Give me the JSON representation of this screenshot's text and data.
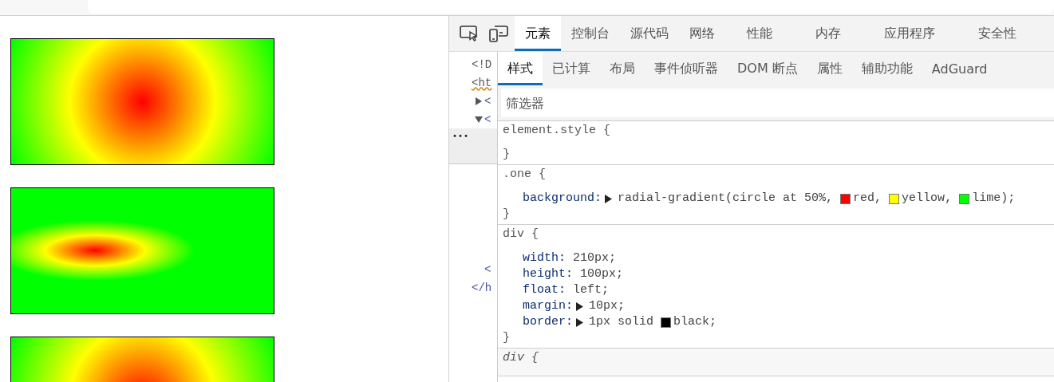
{
  "page": {
    "boxes": [
      {
        "kind": "circle"
      },
      {
        "kind": "ellipse"
      },
      {
        "kind": "circle"
      }
    ]
  },
  "devtools": {
    "tabs": [
      {
        "label": "元素",
        "selected": true
      },
      {
        "label": "控制台",
        "selected": false
      },
      {
        "label": "源代码",
        "selected": false
      },
      {
        "label": "网络",
        "selected": false
      },
      {
        "label": "性能",
        "selected": false
      },
      {
        "label": "内存",
        "selected": false
      },
      {
        "label": "应用程序",
        "selected": false
      },
      {
        "label": "安全性",
        "selected": false
      }
    ],
    "dom_lines": [
      {
        "text": "<!D"
      },
      {
        "text": "<ht"
      },
      {
        "text": "<",
        "expanded": false
      },
      {
        "text": "<",
        "expanded": true
      },
      {
        "text": "<"
      },
      {
        "text": "</h"
      }
    ],
    "more_button": "•••",
    "subtabs": [
      {
        "label": "样式",
        "selected": true
      },
      {
        "label": "已计算",
        "selected": false
      },
      {
        "label": "布局",
        "selected": false
      },
      {
        "label": "事件侦听器",
        "selected": false
      },
      {
        "label": "DOM 断点",
        "selected": false
      },
      {
        "label": "属性",
        "selected": false
      },
      {
        "label": "辅助功能",
        "selected": false
      },
      {
        "label": "AdGuard",
        "selected": false
      }
    ],
    "filter": {
      "placeholder": "筛选器"
    },
    "rules": [
      {
        "selector": "element.style {",
        "close": "}",
        "user_agent": false
      },
      {
        "selector": ".one {",
        "close": "}",
        "user_agent": false,
        "declarations": [
          {
            "property": "background:",
            "expandable": true,
            "value": [
              {
                "kind": "text",
                "text": "radial-gradient(circle at 50%, "
              },
              {
                "kind": "color",
                "color": "#ff0000",
                "text": "red"
              },
              {
                "kind": "text",
                "text": ", "
              },
              {
                "kind": "color",
                "color": "#ffff00",
                "text": "yellow"
              },
              {
                "kind": "text",
                "text": ", "
              },
              {
                "kind": "color",
                "color": "#00ff00",
                "text": "lime"
              },
              {
                "kind": "text",
                "text": ");"
              }
            ]
          }
        ]
      },
      {
        "selector": "div {",
        "close": "}",
        "user_agent": false,
        "declarations": [
          {
            "property": "width:",
            "expandable": false,
            "value": [
              {
                "kind": "text",
                "text": "210px;"
              }
            ]
          },
          {
            "property": "height:",
            "expandable": false,
            "value": [
              {
                "kind": "text",
                "text": "100px;"
              }
            ]
          },
          {
            "property": "float:",
            "expandable": false,
            "value": [
              {
                "kind": "text",
                "text": "left;"
              }
            ]
          },
          {
            "property": "margin:",
            "expandable": true,
            "value": [
              {
                "kind": "text",
                "text": "10px;"
              }
            ]
          },
          {
            "property": "border:",
            "expandable": true,
            "value": [
              {
                "kind": "text",
                "text": "1px solid "
              },
              {
                "kind": "color",
                "color": "#000000",
                "text": "black;"
              }
            ]
          }
        ]
      },
      {
        "selector": "div {",
        "user_agent": true
      }
    ]
  }
}
